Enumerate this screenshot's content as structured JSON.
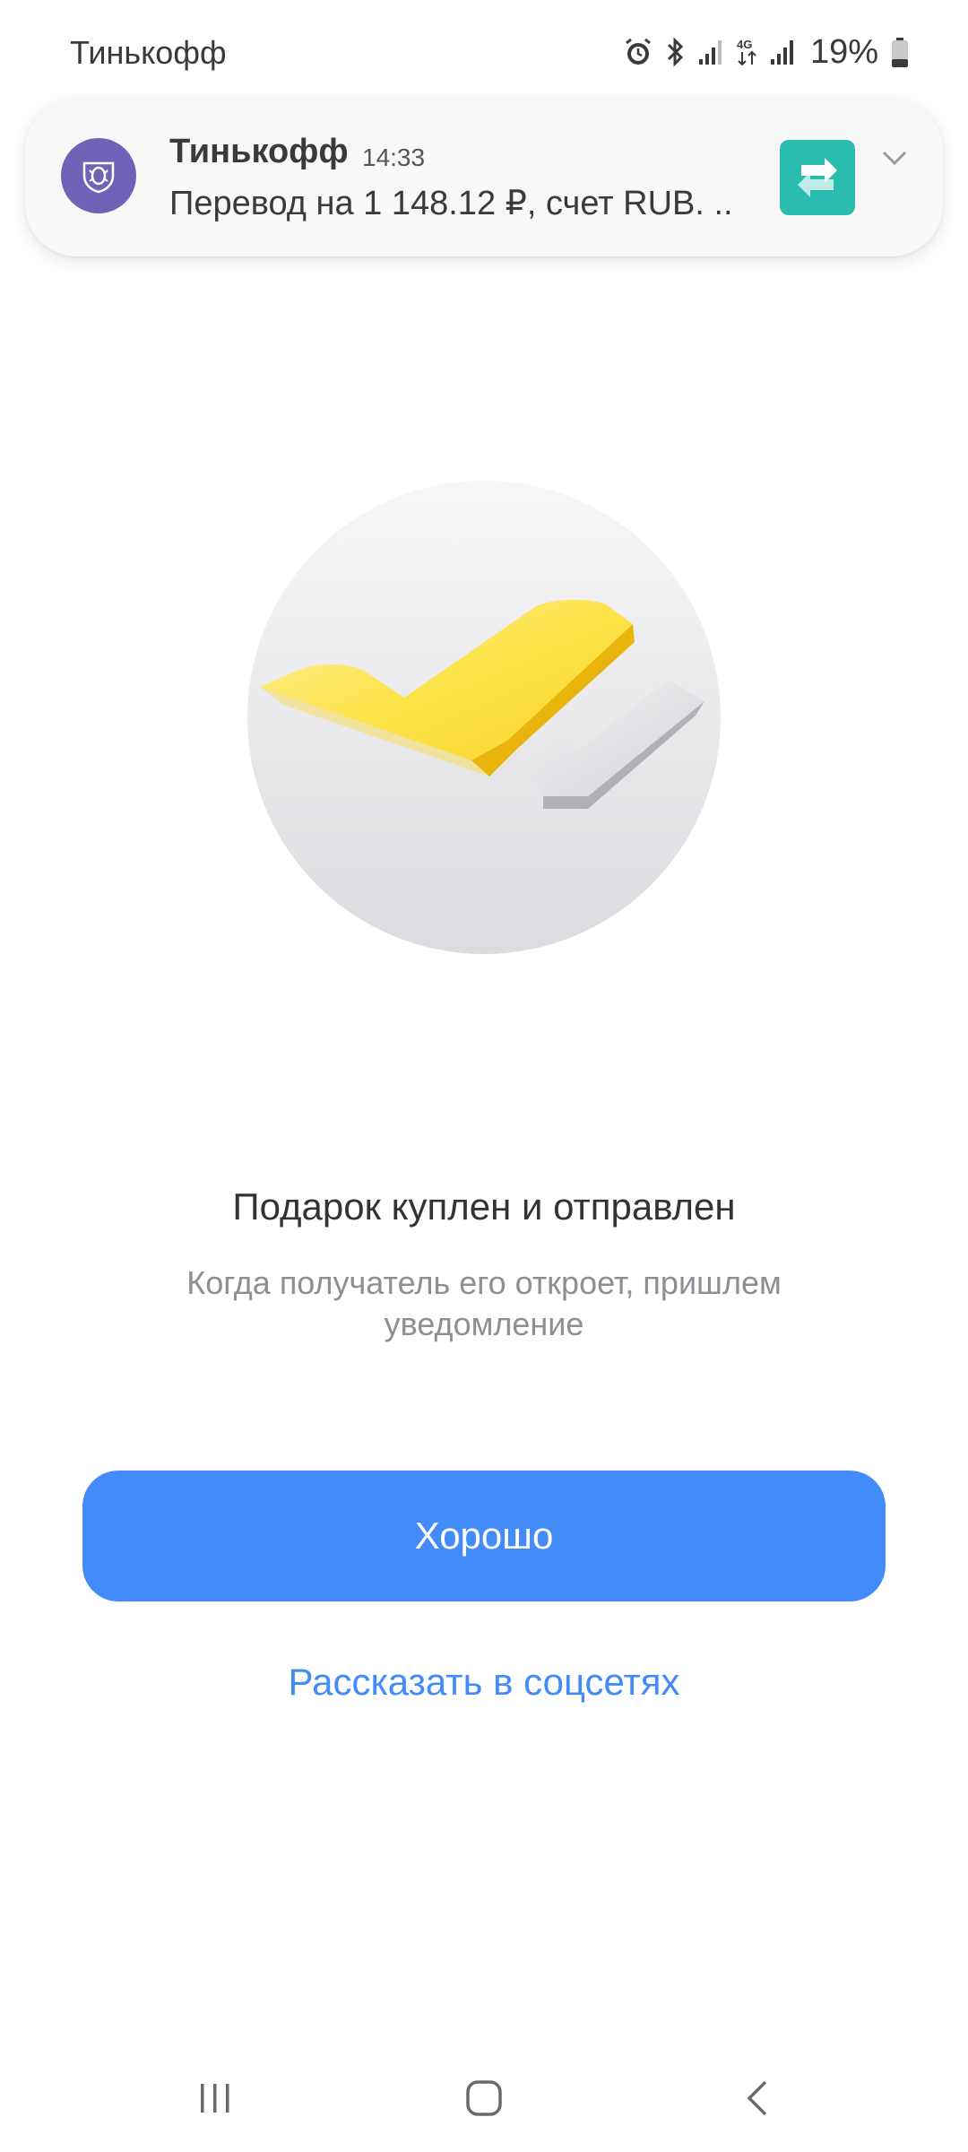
{
  "status_bar": {
    "carrier": "Тинькофф",
    "network": "4G",
    "battery": "19%",
    "icons": [
      "alarm-icon",
      "bluetooth-icon",
      "signal-icon",
      "network-4g-icon",
      "signal-icon",
      "battery-icon"
    ]
  },
  "notification": {
    "app_name": "Тинькофф",
    "time": "14:33",
    "text": "Перевод на 1 148.12 ₽, счет RUB. ..",
    "app_icon": "tinkoff-logo-icon",
    "thumbnail_icon": "transfer-arrows-icon",
    "expand_icon": "chevron-down-icon"
  },
  "illustration": {
    "icon": "double-checkmark-icon"
  },
  "main": {
    "title": "Подарок куплен и отправлен",
    "subtitle": "Когда получатель его откроет, пришлем уведомление",
    "primary_button": "Хорошо",
    "share_link": "Рассказать в соцсетях"
  },
  "nav_bar": {
    "icons": [
      "recent-apps-icon",
      "home-icon",
      "back-icon"
    ]
  },
  "colors": {
    "accent": "#428bf9",
    "gold": "#fbd92c",
    "app_icon_bg": "#6f63b8",
    "thumb_bg": "#2bbcb0"
  }
}
